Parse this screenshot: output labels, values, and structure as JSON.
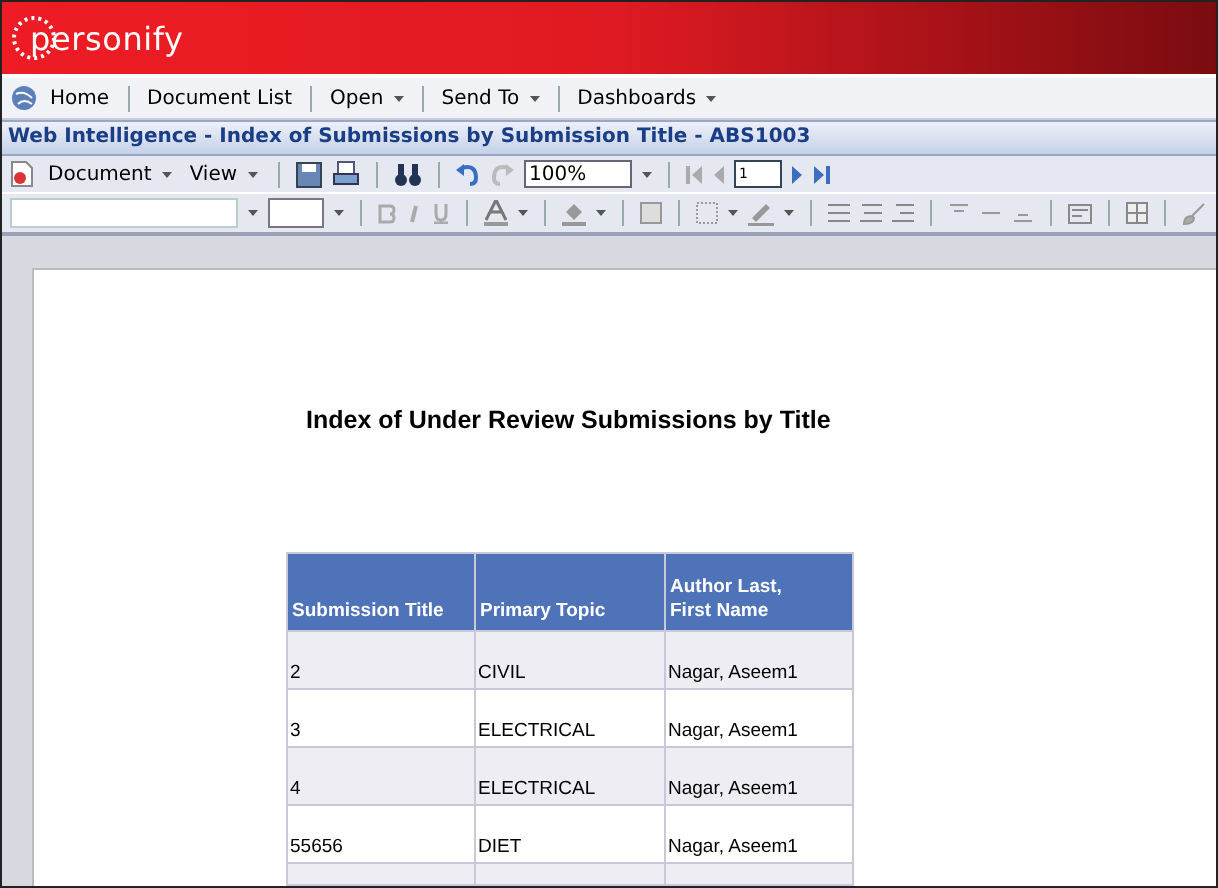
{
  "header": {
    "logo": "personify"
  },
  "nav": {
    "items": [
      {
        "label": "Home",
        "kind": "link"
      },
      {
        "label": "Document List",
        "kind": "link"
      },
      {
        "label": "Open",
        "kind": "menu"
      },
      {
        "label": "Send To",
        "kind": "menu"
      },
      {
        "label": "Dashboards",
        "kind": "menu"
      }
    ]
  },
  "window": {
    "title": "Web Intelligence - Index of Submissions by Submission Title - ABS1003"
  },
  "toolbar": {
    "menus": [
      "Document",
      "View"
    ],
    "zoom": "100%",
    "page": "1"
  },
  "report": {
    "title": "Index of Under Review Submissions by Title",
    "table": {
      "columns": [
        "Submission Title",
        "Primary Topic",
        "Author Last,\nFirst Name"
      ],
      "rows": [
        [
          "2",
          "CIVIL",
          "Nagar, Aseem1"
        ],
        [
          "3",
          "ELECTRICAL",
          "Nagar, Aseem1"
        ],
        [
          "4",
          "ELECTRICAL",
          "Nagar, Aseem1"
        ],
        [
          "55656",
          "DIET",
          "Nagar, Aseem1"
        ]
      ]
    }
  }
}
